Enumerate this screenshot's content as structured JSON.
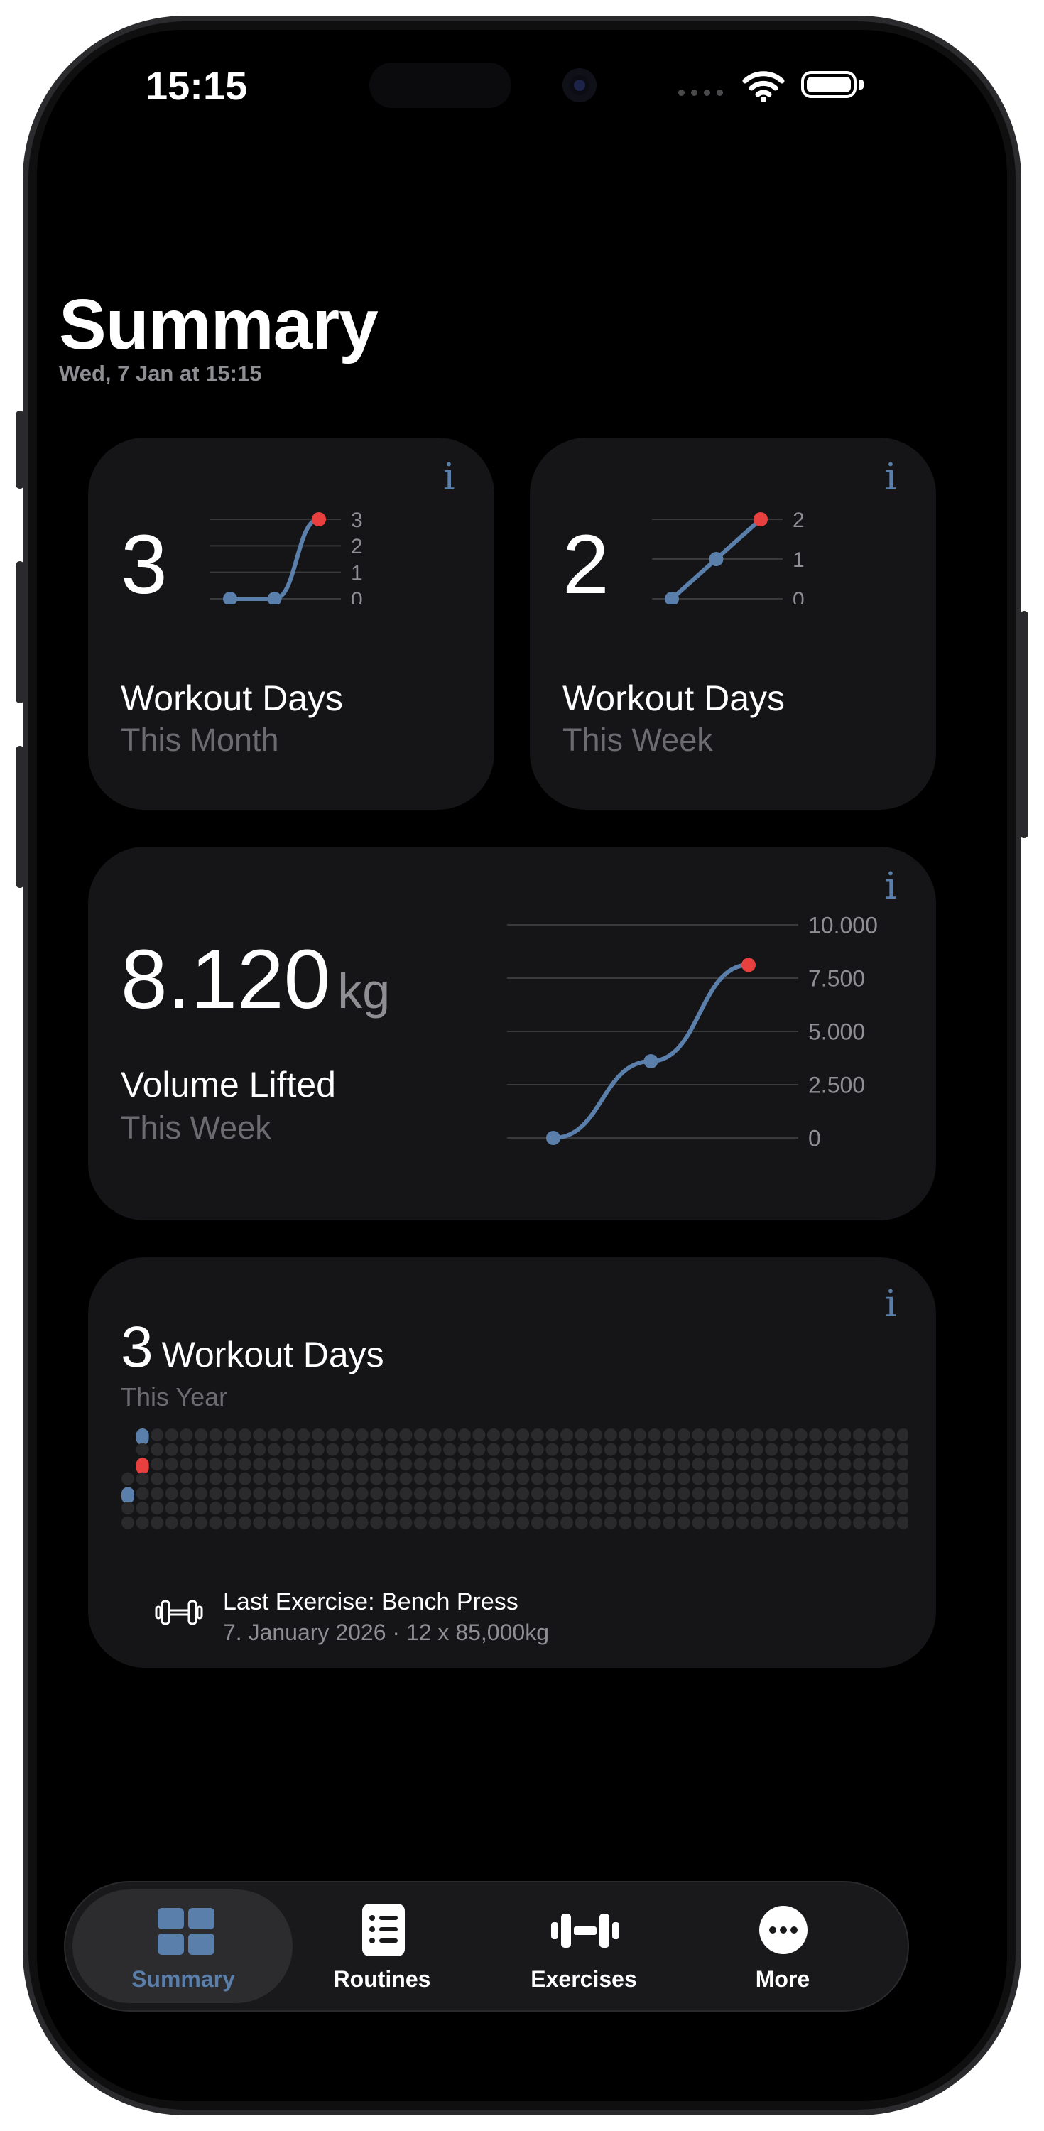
{
  "status_bar": {
    "time": "15:15"
  },
  "header": {
    "title": "Summary",
    "subtitle": "Wed, 7 Jan at 15:15"
  },
  "cards": {
    "month": {
      "value": "3",
      "label": "Workout Days",
      "sublabel": "This Month",
      "chart_data": {
        "type": "line",
        "values": [
          0,
          0,
          3
        ],
        "ylim": [
          0,
          3
        ],
        "yticks": [
          "3",
          "2",
          "1",
          "0"
        ]
      }
    },
    "week": {
      "value": "2",
      "label": "Workout Days",
      "sublabel": "This Week",
      "chart_data": {
        "type": "line",
        "values": [
          0,
          1,
          2
        ],
        "ylim": [
          0,
          2
        ],
        "yticks": [
          "2",
          "1",
          "0"
        ]
      }
    },
    "volume": {
      "value": "8.120",
      "unit": "kg",
      "label": "Volume Lifted",
      "sublabel": "This Week",
      "chart_data": {
        "type": "line",
        "values": [
          0,
          3600,
          8120
        ],
        "ylim": [
          0,
          10000
        ],
        "yticks": [
          "10.000",
          "7.500",
          "5.000",
          "2.500",
          "0"
        ]
      }
    },
    "year": {
      "value": "3",
      "label": "Workout Days",
      "sublabel": "This Year",
      "heatmap": {
        "columns": 54,
        "rows": 7,
        "active_cells": [
          [
            0,
            0
          ],
          [
            0,
            2
          ],
          [
            -1,
            4
          ]
        ]
      },
      "last_exercise": {
        "title": "Last Exercise: Bench Press",
        "detail": "7. January 2026 · 12 x 85,000kg"
      }
    }
  },
  "colors": {
    "accent": "#5a7fab",
    "highlight": "#e8403f",
    "card": "#151517"
  },
  "tabs": [
    {
      "label": "Summary",
      "icon": "grid-icon",
      "active": true
    },
    {
      "label": "Routines",
      "icon": "list-icon",
      "active": false
    },
    {
      "label": "Exercises",
      "icon": "dumbbell-icon",
      "active": false
    },
    {
      "label": "More",
      "icon": "more-icon",
      "active": false
    }
  ]
}
